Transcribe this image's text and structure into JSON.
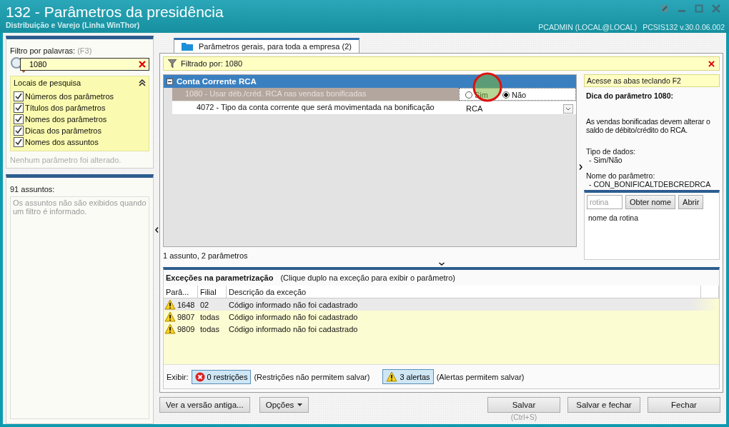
{
  "window": {
    "title": "132 - Parâmetros da presidência",
    "subtitle": "Distribuição e Varejo (Linha WinThor)",
    "user": "PCADMIN (LOCAL@LOCAL)",
    "version": "PCSIS132  v.30.0.06.002"
  },
  "filter": {
    "label": "Filtro por palavras:",
    "hotkey": "(F3)",
    "value": "1080"
  },
  "search_locations": {
    "title": "Locais de pesquisa",
    "expanded": true,
    "options": [
      {
        "label": "Números dos parâmetros",
        "checked": true
      },
      {
        "label": "Títulos dos parâmetros",
        "checked": true
      },
      {
        "label": "Nomes dos parâmetros",
        "checked": true
      },
      {
        "label": "Dicas dos parâmetros",
        "checked": true
      },
      {
        "label": "Nomes dos assuntos",
        "checked": true
      }
    ]
  },
  "status_note": "Nenhum parâmetro foi alterado.",
  "subjects": {
    "count_label": "91 assuntos:",
    "note": "Os assuntos não são exibidos quando um filtro é informado."
  },
  "tabs": [
    {
      "label": "Parâmetros gerais, para toda a empresa  (2)",
      "selected": true
    }
  ],
  "filter_bar": {
    "text": "Filtrado por: 1080"
  },
  "group": {
    "title": "Conta Corrente RCA",
    "expanded": true,
    "rows": [
      {
        "kind": "radio",
        "label": "1080 - Usar déb./créd. RCA nas vendas bonificadas",
        "selected": true,
        "options": [
          {
            "label": "Sim",
            "selected": false
          },
          {
            "label": "Não",
            "selected": true
          }
        ]
      },
      {
        "kind": "dropdown",
        "label": "4072 - Tipo da conta corrente que será movimentada na bonificação",
        "selected": false,
        "value": "RCA"
      }
    ]
  },
  "summary": "1 assunto, 2 parâmetros",
  "tip": {
    "hint": "Acesse as abas teclando F2",
    "title": "Dica do parâmetro 1080:",
    "description": "As vendas bonificadas devem alterar o saldo de débito/crédito do RCA.",
    "data_type_label": "Tipo de dados:",
    "data_type_value": "- Sim/Não",
    "name_label": "Nome do parâmetro:",
    "name_value": "- CON_BONIFICALTDEBCREDRCA"
  },
  "routine": {
    "placeholder": "rotina",
    "buttons": [
      "Obter nome",
      "Abrir"
    ],
    "note": "nome da rotina"
  },
  "exceptions": {
    "title": "Exceções na parametrização",
    "hint": "(Clique duplo na exceção para exibir o parâmetro)",
    "columns": [
      "Parâ...",
      "Filial",
      "Descrição da exceção"
    ],
    "rows": [
      {
        "param": "1648",
        "branch": "02",
        "description": "Código informado não foi cadastrado",
        "selected": true
      },
      {
        "param": "9807",
        "branch": "todas",
        "description": "Código informado não foi cadastrado",
        "selected": false
      },
      {
        "param": "9809",
        "branch": "todas",
        "description": "Código informado não foi cadastrado",
        "selected": false
      }
    ]
  },
  "show_bar": {
    "label": "Exibir:",
    "items": [
      {
        "kind": "error",
        "label": "0 restrições",
        "note": "(Restrições não permitem salvar)"
      },
      {
        "kind": "warning",
        "label": "3 alertas",
        "note": "(Alertas permitem salvar)"
      }
    ]
  },
  "footer": {
    "left_buttons": [
      {
        "label": "Ver a versão antiga...",
        "dropdown": false
      },
      {
        "label": "Opções",
        "dropdown": true
      }
    ],
    "right_buttons": [
      {
        "label": "Salvar",
        "shortcut": "(Ctrl+S)"
      },
      {
        "label": "Salvar e fechar"
      },
      {
        "label": "Fechar"
      }
    ]
  }
}
